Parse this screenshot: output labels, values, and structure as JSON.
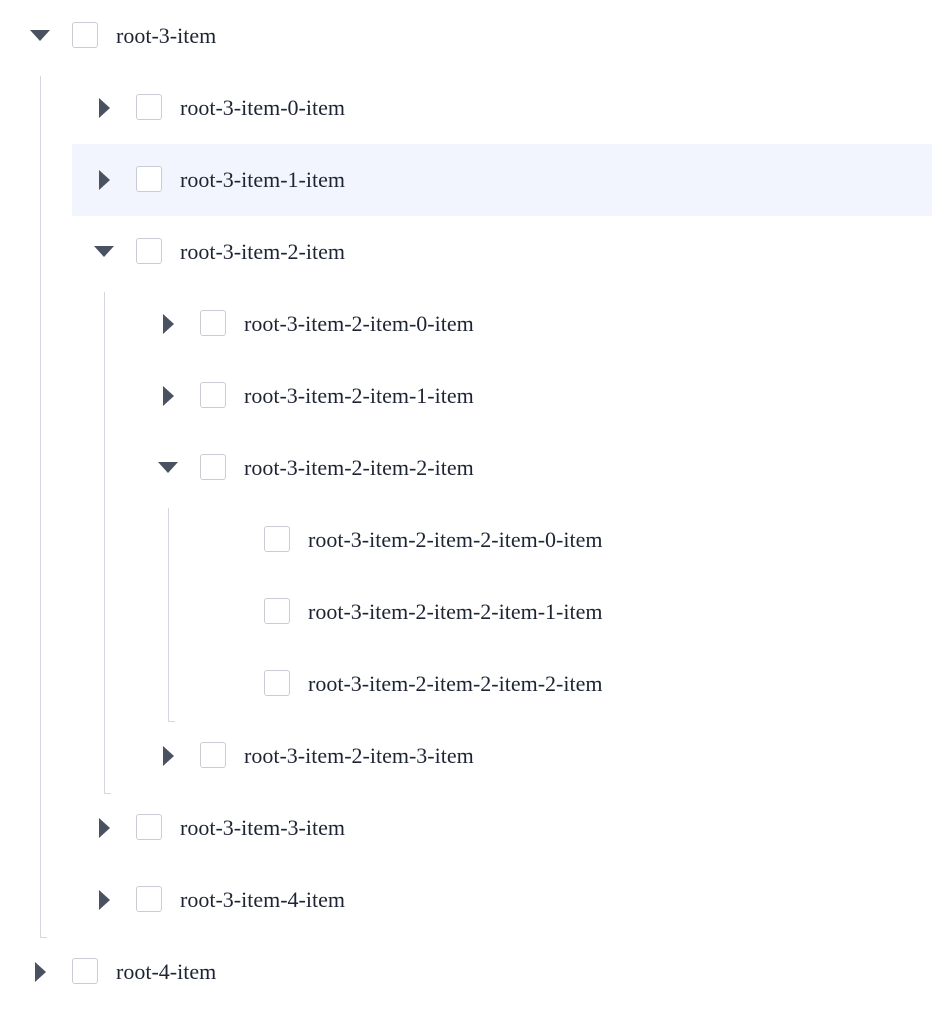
{
  "tree": {
    "items": [
      {
        "label": "root-3-item",
        "level": 0,
        "toggle": "expanded",
        "toggle_icon": "caret-down-icon",
        "checked": false,
        "hovered": false
      },
      {
        "label": "root-3-item-0-item",
        "level": 1,
        "toggle": "collapsed",
        "toggle_icon": "caret-right-icon",
        "checked": false,
        "hovered": false
      },
      {
        "label": "root-3-item-1-item",
        "level": 1,
        "toggle": "collapsed",
        "toggle_icon": "caret-right-icon",
        "checked": false,
        "hovered": true
      },
      {
        "label": "root-3-item-2-item",
        "level": 1,
        "toggle": "expanded",
        "toggle_icon": "caret-down-icon",
        "checked": false,
        "hovered": false
      },
      {
        "label": "root-3-item-2-item-0-item",
        "level": 2,
        "toggle": "collapsed",
        "toggle_icon": "caret-right-icon",
        "checked": false,
        "hovered": false
      },
      {
        "label": "root-3-item-2-item-1-item",
        "level": 2,
        "toggle": "collapsed",
        "toggle_icon": "caret-right-icon",
        "checked": false,
        "hovered": false
      },
      {
        "label": "root-3-item-2-item-2-item",
        "level": 2,
        "toggle": "expanded",
        "toggle_icon": "caret-down-icon",
        "checked": false,
        "hovered": false
      },
      {
        "label": "root-3-item-2-item-2-item-0-item",
        "level": 3,
        "toggle": "none",
        "toggle_icon": "",
        "checked": false,
        "hovered": false
      },
      {
        "label": "root-3-item-2-item-2-item-1-item",
        "level": 3,
        "toggle": "none",
        "toggle_icon": "",
        "checked": false,
        "hovered": false
      },
      {
        "label": "root-3-item-2-item-2-item-2-item",
        "level": 3,
        "toggle": "none",
        "toggle_icon": "",
        "checked": false,
        "hovered": false
      },
      {
        "label": "root-3-item-2-item-3-item",
        "level": 2,
        "toggle": "collapsed",
        "toggle_icon": "caret-right-icon",
        "checked": false,
        "hovered": false
      },
      {
        "label": "root-3-item-3-item",
        "level": 1,
        "toggle": "collapsed",
        "toggle_icon": "caret-right-icon",
        "checked": false,
        "hovered": false
      },
      {
        "label": "root-3-item-4-item",
        "level": 1,
        "toggle": "collapsed",
        "toggle_icon": "caret-right-icon",
        "checked": false,
        "hovered": false
      },
      {
        "label": "root-4-item",
        "level": 0,
        "toggle": "collapsed",
        "toggle_icon": "caret-right-icon",
        "checked": false,
        "hovered": false
      }
    ]
  },
  "colors": {
    "caret": "#4a5262",
    "text": "#1d2433",
    "checkbox_border": "#c9ccd2",
    "guide_line": "#d3d7df",
    "hover_background": "#f2f5fd"
  }
}
